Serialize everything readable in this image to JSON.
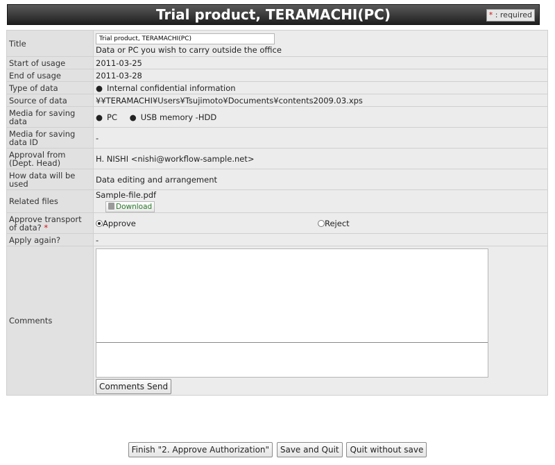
{
  "header": {
    "title": "Trial product, TERAMACHI(PC)",
    "required_star": "*",
    "required_text": " : required"
  },
  "form": {
    "title": {
      "label": "Title",
      "input_value": "Trial product, TERAMACHI(PC)",
      "subtext": "Data or PC you wish to carry outside the office"
    },
    "start": {
      "label": "Start of usage",
      "value": "2011-03-25"
    },
    "end": {
      "label": "End of usage",
      "value": "2011-03-28"
    },
    "type": {
      "label": "Type of data",
      "value": "Internal confidential information"
    },
    "source": {
      "label": "Source of data",
      "value": "¥¥TERAMACHI¥Users¥Tsujimoto¥Documents¥contents2009.03.xps"
    },
    "media": {
      "label": "Media for saving data",
      "items": [
        "PC",
        "USB memory -HDD"
      ]
    },
    "media_id": {
      "label": "Media for saving data ID",
      "value": "-"
    },
    "approval": {
      "label": "Approval from (Dept. Head)",
      "value": "H. NISHI <nishi@workflow-sample.net>"
    },
    "usage": {
      "label": "How data will be used",
      "value": "Data editing and arrangement"
    },
    "files": {
      "label": "Related files",
      "file_name": "Sample-file.pdf",
      "download_label": "Download"
    },
    "approve": {
      "label": "Approve transport of data?",
      "required_star": "*",
      "options": [
        "Approve",
        "Reject"
      ],
      "selected": "Approve"
    },
    "apply_again": {
      "label": "Apply again?",
      "value": "-"
    },
    "comments": {
      "label": "Comments",
      "send_label": "Comments Send"
    }
  },
  "actions": {
    "finish_label": "Finish \"2. Approve Authorization\"",
    "save_quit_label": "Save and Quit",
    "quit_label": "Quit without save"
  },
  "colors": {
    "header_bg": "#2e2e2e",
    "label_bg": "#e1e1e1",
    "value_bg": "#ececec",
    "required": "#d01010",
    "download_text": "#2a7a2a"
  }
}
